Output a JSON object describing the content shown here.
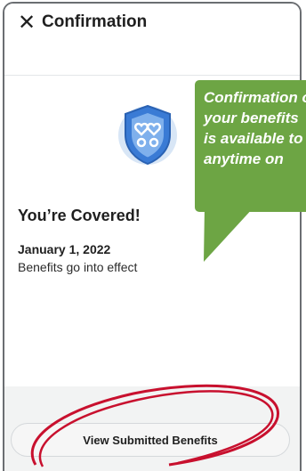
{
  "header": {
    "close_glyph": "✕",
    "title": "Confirmation"
  },
  "status": {
    "icon": "shield-hearts-icon",
    "title": "You’re Covered!",
    "date": "January 1, 2022",
    "description": "Benefits go into effect"
  },
  "actions": {
    "view_button_label": "View Submitted Benefits"
  },
  "callout": {
    "text": "Confirmation of\nyour benefits\nis available to\nanytime on",
    "color": "#6da544"
  },
  "annotation": {
    "ellipse_color": "#c8102e"
  }
}
